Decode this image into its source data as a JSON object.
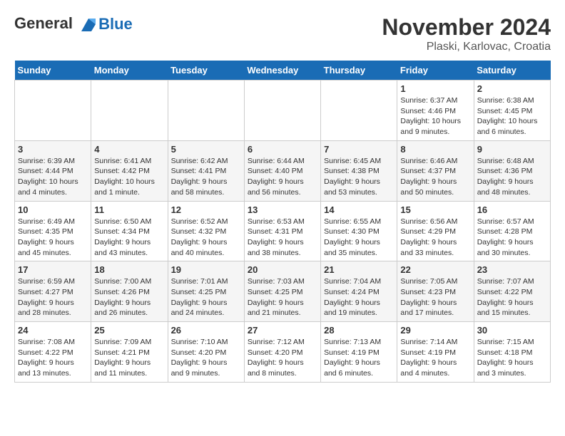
{
  "header": {
    "logo_line1": "General",
    "logo_line2": "Blue",
    "month": "November 2024",
    "location": "Plaski, Karlovac, Croatia"
  },
  "weekdays": [
    "Sunday",
    "Monday",
    "Tuesday",
    "Wednesday",
    "Thursday",
    "Friday",
    "Saturday"
  ],
  "weeks": [
    [
      {
        "day": "",
        "info": ""
      },
      {
        "day": "",
        "info": ""
      },
      {
        "day": "",
        "info": ""
      },
      {
        "day": "",
        "info": ""
      },
      {
        "day": "",
        "info": ""
      },
      {
        "day": "1",
        "info": "Sunrise: 6:37 AM\nSunset: 4:46 PM\nDaylight: 10 hours and 9 minutes."
      },
      {
        "day": "2",
        "info": "Sunrise: 6:38 AM\nSunset: 4:45 PM\nDaylight: 10 hours and 6 minutes."
      }
    ],
    [
      {
        "day": "3",
        "info": "Sunrise: 6:39 AM\nSunset: 4:44 PM\nDaylight: 10 hours and 4 minutes."
      },
      {
        "day": "4",
        "info": "Sunrise: 6:41 AM\nSunset: 4:42 PM\nDaylight: 10 hours and 1 minute."
      },
      {
        "day": "5",
        "info": "Sunrise: 6:42 AM\nSunset: 4:41 PM\nDaylight: 9 hours and 58 minutes."
      },
      {
        "day": "6",
        "info": "Sunrise: 6:44 AM\nSunset: 4:40 PM\nDaylight: 9 hours and 56 minutes."
      },
      {
        "day": "7",
        "info": "Sunrise: 6:45 AM\nSunset: 4:38 PM\nDaylight: 9 hours and 53 minutes."
      },
      {
        "day": "8",
        "info": "Sunrise: 6:46 AM\nSunset: 4:37 PM\nDaylight: 9 hours and 50 minutes."
      },
      {
        "day": "9",
        "info": "Sunrise: 6:48 AM\nSunset: 4:36 PM\nDaylight: 9 hours and 48 minutes."
      }
    ],
    [
      {
        "day": "10",
        "info": "Sunrise: 6:49 AM\nSunset: 4:35 PM\nDaylight: 9 hours and 45 minutes."
      },
      {
        "day": "11",
        "info": "Sunrise: 6:50 AM\nSunset: 4:34 PM\nDaylight: 9 hours and 43 minutes."
      },
      {
        "day": "12",
        "info": "Sunrise: 6:52 AM\nSunset: 4:32 PM\nDaylight: 9 hours and 40 minutes."
      },
      {
        "day": "13",
        "info": "Sunrise: 6:53 AM\nSunset: 4:31 PM\nDaylight: 9 hours and 38 minutes."
      },
      {
        "day": "14",
        "info": "Sunrise: 6:55 AM\nSunset: 4:30 PM\nDaylight: 9 hours and 35 minutes."
      },
      {
        "day": "15",
        "info": "Sunrise: 6:56 AM\nSunset: 4:29 PM\nDaylight: 9 hours and 33 minutes."
      },
      {
        "day": "16",
        "info": "Sunrise: 6:57 AM\nSunset: 4:28 PM\nDaylight: 9 hours and 30 minutes."
      }
    ],
    [
      {
        "day": "17",
        "info": "Sunrise: 6:59 AM\nSunset: 4:27 PM\nDaylight: 9 hours and 28 minutes."
      },
      {
        "day": "18",
        "info": "Sunrise: 7:00 AM\nSunset: 4:26 PM\nDaylight: 9 hours and 26 minutes."
      },
      {
        "day": "19",
        "info": "Sunrise: 7:01 AM\nSunset: 4:25 PM\nDaylight: 9 hours and 24 minutes."
      },
      {
        "day": "20",
        "info": "Sunrise: 7:03 AM\nSunset: 4:25 PM\nDaylight: 9 hours and 21 minutes."
      },
      {
        "day": "21",
        "info": "Sunrise: 7:04 AM\nSunset: 4:24 PM\nDaylight: 9 hours and 19 minutes."
      },
      {
        "day": "22",
        "info": "Sunrise: 7:05 AM\nSunset: 4:23 PM\nDaylight: 9 hours and 17 minutes."
      },
      {
        "day": "23",
        "info": "Sunrise: 7:07 AM\nSunset: 4:22 PM\nDaylight: 9 hours and 15 minutes."
      }
    ],
    [
      {
        "day": "24",
        "info": "Sunrise: 7:08 AM\nSunset: 4:22 PM\nDaylight: 9 hours and 13 minutes."
      },
      {
        "day": "25",
        "info": "Sunrise: 7:09 AM\nSunset: 4:21 PM\nDaylight: 9 hours and 11 minutes."
      },
      {
        "day": "26",
        "info": "Sunrise: 7:10 AM\nSunset: 4:20 PM\nDaylight: 9 hours and 9 minutes."
      },
      {
        "day": "27",
        "info": "Sunrise: 7:12 AM\nSunset: 4:20 PM\nDaylight: 9 hours and 8 minutes."
      },
      {
        "day": "28",
        "info": "Sunrise: 7:13 AM\nSunset: 4:19 PM\nDaylight: 9 hours and 6 minutes."
      },
      {
        "day": "29",
        "info": "Sunrise: 7:14 AM\nSunset: 4:19 PM\nDaylight: 9 hours and 4 minutes."
      },
      {
        "day": "30",
        "info": "Sunrise: 7:15 AM\nSunset: 4:18 PM\nDaylight: 9 hours and 3 minutes."
      }
    ]
  ]
}
